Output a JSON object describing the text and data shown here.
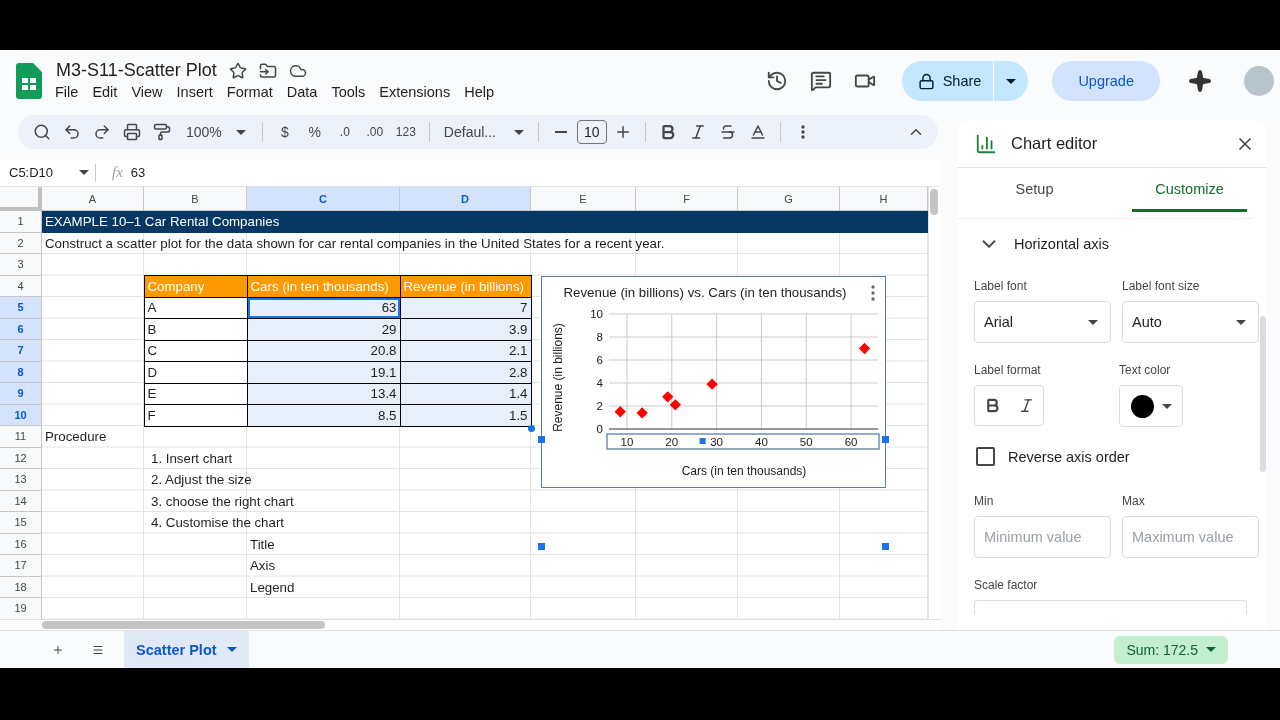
{
  "document": {
    "title": "M3-S11-Scatter Plot"
  },
  "menu": [
    "File",
    "Edit",
    "View",
    "Insert",
    "Format",
    "Data",
    "Tools",
    "Extensions",
    "Help"
  ],
  "header_actions": {
    "share": "Share",
    "upgrade": "Upgrade"
  },
  "toolbar": {
    "zoom": "100%",
    "currency": "$",
    "percent": "%",
    "decrease_decimals": ".0",
    "increase_decimals": ".00",
    "number_format": "123",
    "font": "Defaul...",
    "font_size": "10"
  },
  "formula_bar": {
    "name_box": "C5:D10",
    "function_label": "fx",
    "value": "63"
  },
  "column_headers": [
    {
      "label": "A",
      "selected": false
    },
    {
      "label": "B",
      "selected": false
    },
    {
      "label": "C",
      "selected": true
    },
    {
      "label": "D",
      "selected": true
    },
    {
      "label": "E",
      "selected": false
    },
    {
      "label": "F",
      "selected": false
    },
    {
      "label": "G",
      "selected": false
    },
    {
      "label": "H",
      "selected": false
    }
  ],
  "row_numbers": [
    {
      "label": "1",
      "selected": false
    },
    {
      "label": "2",
      "selected": false
    },
    {
      "label": "3",
      "selected": false
    },
    {
      "label": "4",
      "selected": false
    },
    {
      "label": "5",
      "selected": true
    },
    {
      "label": "6",
      "selected": true
    },
    {
      "label": "7",
      "selected": true
    },
    {
      "label": "8",
      "selected": true
    },
    {
      "label": "9",
      "selected": true
    },
    {
      "label": "10",
      "selected": true
    },
    {
      "label": "11",
      "selected": false
    },
    {
      "label": "12",
      "selected": false
    },
    {
      "label": "13",
      "selected": false
    },
    {
      "label": "14",
      "selected": false
    },
    {
      "label": "15",
      "selected": false
    },
    {
      "label": "16",
      "selected": false
    },
    {
      "label": "17",
      "selected": false
    },
    {
      "label": "18",
      "selected": false
    },
    {
      "label": "19",
      "selected": false
    }
  ],
  "sheet": {
    "banner": "EXAMPLE 10–1 Car Rental Companies",
    "prompt": "Construct a scatter plot for the data shown for car rental companies in the United States for a recent year.",
    "data_table": {
      "columns": [
        "Company",
        "Cars (in ten thousands)",
        "Revenue (in billions)"
      ],
      "rows": [
        {
          "cells": [
            "A",
            "63",
            "7"
          ],
          "selected": true,
          "active": true
        },
        {
          "cells": [
            "B",
            "29",
            "3.9"
          ],
          "selected": true,
          "active": false
        },
        {
          "cells": [
            "C",
            "20.8",
            "2.1"
          ],
          "selected": true,
          "active": false
        },
        {
          "cells": [
            "D",
            "19.1",
            "2.8"
          ],
          "selected": true,
          "active": false
        },
        {
          "cells": [
            "E",
            "13.4",
            "1.4"
          ],
          "selected": true,
          "active": false
        },
        {
          "cells": [
            "F",
            "8.5",
            "1.5"
          ],
          "selected": true,
          "active": false
        }
      ]
    },
    "procedure": {
      "heading": "Procedure",
      "steps": [
        "1. Insert chart",
        "2. Adjust the size",
        "3. choose the right chart",
        "4. Customise the chart"
      ],
      "sub_items": [
        "Title",
        "Axis",
        "Legend"
      ]
    }
  },
  "chart": {
    "chart_data": {
      "type": "scatter",
      "title": "Revenue (in billions) vs. Cars (in ten thousands)",
      "xlabel": "Cars (in ten thousands)",
      "ylabel": "Revenue (in billions)",
      "x": [
        63,
        29,
        20.8,
        19.1,
        13.4,
        8.5
      ],
      "series": [
        {
          "color": "#ff0000",
          "values": [
            7,
            3.9,
            2.1,
            2.8,
            1.4,
            1.5
          ]
        }
      ],
      "xlim": [
        6,
        66
      ],
      "ylim": [
        0,
        10
      ],
      "xticks": [
        10,
        20,
        30,
        40,
        50,
        60
      ],
      "yticks": [
        0,
        2,
        4,
        6,
        8,
        10
      ],
      "grid": true
    }
  },
  "chart_editor": {
    "title": "Chart editor",
    "tabs": [
      {
        "label": "Setup",
        "selected": false
      },
      {
        "label": "Customize",
        "selected": true
      }
    ],
    "section": {
      "title": "Horizontal axis",
      "expanded": true,
      "label_font": {
        "label": "Label font",
        "value": "Arial"
      },
      "label_font_size": {
        "label": "Label font size",
        "value": "Auto"
      },
      "label_format": {
        "label": "Label format"
      },
      "text_color": {
        "label": "Text color",
        "color": "#000000"
      },
      "reverse_axis_order": {
        "label": "Reverse axis order",
        "checked": false
      },
      "min": {
        "label": "Min",
        "placeholder": "Minimum value"
      },
      "max": {
        "label": "Max",
        "placeholder": "Maximum value"
      },
      "scale_factor": {
        "label": "Scale factor"
      }
    }
  },
  "sheet_tabs": [
    {
      "label": "Scatter Plot",
      "selected": true
    }
  ],
  "status": {
    "sum": "Sum: 172.5"
  }
}
